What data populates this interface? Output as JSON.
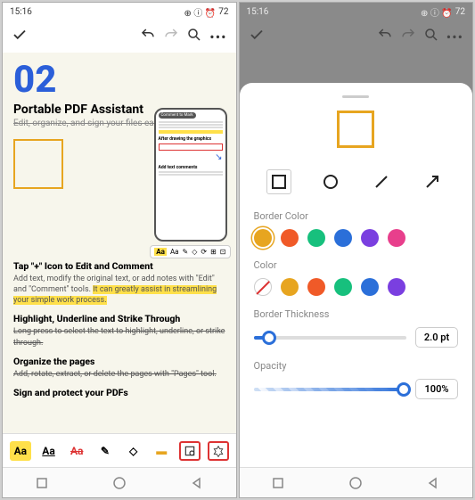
{
  "status": {
    "time": "15:16",
    "battery": "72"
  },
  "left": {
    "big": "02",
    "title": "Portable PDF Assistant",
    "subtitle": "Edit, organize, and sign your files easily.",
    "mock": {
      "tab": "Comment to Mark",
      "sec1": "After drawing the graphics",
      "sec2": "Add text comments"
    },
    "sections": {
      "s1h": "Tap \"+\" Icon to Edit and Comment",
      "s1p_a": "Add text, modify the original text, or add notes with \"Edit\" and \"Comment\" tools. ",
      "s1p_b": "It can greatly assist in streamlining your simple work process.",
      "s2h": "Highlight, Underline and Strike Through",
      "s2p": "Long press to select the text to highlight, underline, or strike through.",
      "s3h": "Organize the pages",
      "s3p": "Add, rotate, extract, or delete the pages with \"Pages\" tool.",
      "s4h": "Sign and protect your PDFs"
    },
    "ctx": {
      "aa1": "Aa",
      "aa2": "Aa"
    }
  },
  "panel": {
    "labels": {
      "borderColor": "Border Color",
      "color": "Color",
      "thickness": "Border Thickness",
      "opacity": "Opacity"
    },
    "borderColors": [
      "#e7a520",
      "#f05a28",
      "#17c07d",
      "#2b6fd9",
      "#7a3fe0",
      "#e83f8c"
    ],
    "fillColors": [
      "#e7a520",
      "#f05a28",
      "#17c07d",
      "#2b6fd9",
      "#7a3fe0"
    ],
    "thickness": "2.0 pt",
    "opacity": "100%"
  }
}
